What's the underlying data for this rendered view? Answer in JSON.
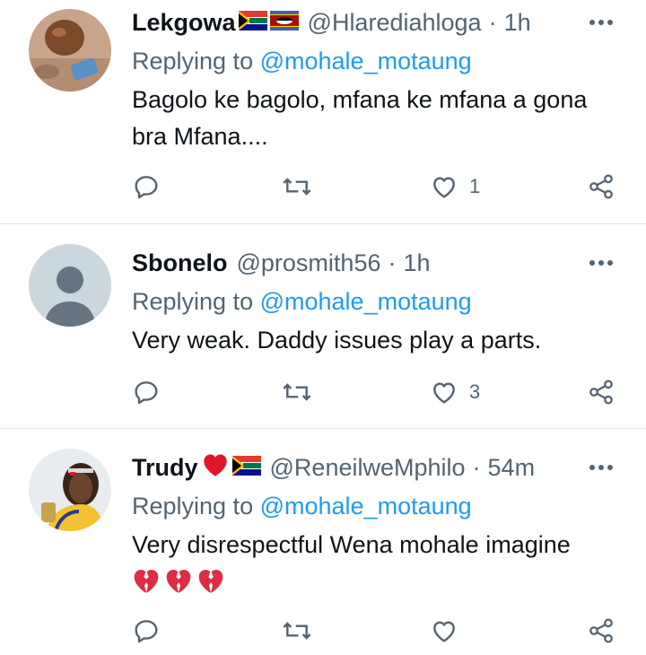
{
  "tweets": [
    {
      "name": "Lekgowa",
      "handle": "@Hlarediahloga",
      "time": "1h",
      "replying_prefix": "Replying to",
      "replying_to": "@mohale_motaung",
      "text_lines": [
        "Bagolo ke bagolo, mfana ke mfana a gona",
        "bra Mfana...."
      ],
      "like_count": "1",
      "flags": [
        "south-africa-flag",
        "eswatini-flag"
      ]
    },
    {
      "name": "Sbonelo",
      "handle": "@prosmith56",
      "time": "1h",
      "replying_prefix": "Replying to",
      "replying_to": "@mohale_motaung",
      "text_lines": [
        "Very weak. Daddy issues play a parts."
      ],
      "like_count": "3",
      "avatar": "default-avatar-icon"
    },
    {
      "name": "Trudy",
      "handle": "@ReneilweMphilo",
      "time": "54m",
      "replying_prefix": "Replying to",
      "replying_to": "@mohale_motaung",
      "text_lines": [
        "Very disrespectful Wena mohale imagine"
      ],
      "like_count": "",
      "flags": [
        "red-heart-emoji",
        "south-africa-flag"
      ],
      "emoji_line": [
        "broken-heart-emoji",
        "broken-heart-emoji",
        "broken-heart-emoji"
      ]
    }
  ],
  "colors": {
    "text": "#0f1419",
    "secondary": "#536471",
    "link": "#1d9bf0",
    "divider": "#e1e6ea"
  }
}
